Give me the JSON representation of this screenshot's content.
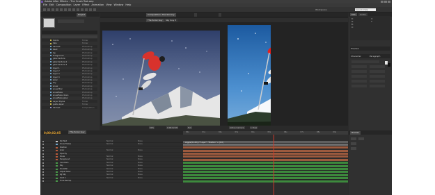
{
  "app": {
    "title": "Adobe After Effects - The Crash Test.aep",
    "menu": [
      "File",
      "Edit",
      "Composition",
      "Layer",
      "Effect",
      "Animation",
      "View",
      "Window",
      "Help"
    ],
    "workspace": "Workspace:",
    "search_placeholder": "Search Help"
  },
  "project": {
    "tab_label": "Project",
    "items": [
      {
        "name": "Solids",
        "type": "Folder",
        "color": "#c9b94c"
      },
      {
        "name": "Skis",
        "type": "Folder",
        "color": "#c9b94c"
      },
      {
        "name": "Ski text",
        "type": "Photoshop",
        "color": "#6fa3c9"
      },
      {
        "name": "back",
        "type": "Photoshop",
        "color": "#6fa3c9"
      },
      {
        "name": "bg",
        "type": "Photoshop",
        "color": "#6fa3c9"
      },
      {
        "name": "foreground",
        "type": "Photoshop",
        "color": "#6fa3c9"
      },
      {
        "name": "glow texture",
        "type": "Photoshop",
        "color": "#6fa3c9"
      },
      {
        "name": "glow texture 2",
        "type": "Photoshop",
        "color": "#6fa3c9"
      },
      {
        "name": "glow texture 3",
        "type": "Photoshop",
        "color": "#6fa3c9"
      },
      {
        "name": "layer 1",
        "type": "Photoshop",
        "color": "#6fa3c9"
      },
      {
        "name": "layer 2",
        "type": "Photoshop",
        "color": "#6fa3c9"
      },
      {
        "name": "layer 3",
        "type": "Photoshop",
        "color": "#6fa3c9"
      },
      {
        "name": "layer 4",
        "type": "Photoshop",
        "color": "#6fa3c9"
      },
      {
        "name": "skier",
        "type": "Photoshop",
        "color": "#6fa3c9"
      },
      {
        "name": "sky",
        "type": "Photoshop",
        "color": "#6fa3c9"
      },
      {
        "name": "snow",
        "type": "Photoshop",
        "color": "#6fa3c9"
      },
      {
        "name": "snow Blur",
        "type": "Photoshop",
        "color": "#6fa3c9"
      },
      {
        "name": "snowflake",
        "type": "Photoshop",
        "color": "#6fa3c9"
      },
      {
        "name": "snowflake down",
        "type": "Photoshop",
        "color": "#6fa3c9"
      },
      {
        "name": "snowflake glow",
        "type": "Photoshop",
        "color": "#6fa3c9"
      },
      {
        "name": "Layer Styles",
        "type": "Folder",
        "color": "#c9b94c"
      },
      {
        "name": "guide layer",
        "type": "Folder",
        "color": "#c9b94c"
      },
      {
        "name": "Ski test",
        "type": "Composition",
        "color": "#8c8cc9"
      }
    ]
  },
  "viewer": {
    "tab_label": "Composition: The Ski Guy",
    "tabs": [
      "The Snow Guy",
      "Sky Guy 2"
    ],
    "footer": [
      "50%",
      "0:00:02:05",
      "Full",
      "Active Camera",
      "1 View"
    ]
  },
  "right_panel": {
    "info_tab": "Info",
    "audio_tab": "Audio",
    "preview_tab": "Preview",
    "char_tab": "Character",
    "paragraph_tab": "Paragraph",
    "values": [
      "R:",
      "G:",
      "B:",
      "A:",
      "X:",
      "Y:"
    ]
  },
  "timeline": {
    "timecode": "0;00;02;05",
    "tab_label": "The Snow Guy",
    "ticks": [
      "00s",
      "01s",
      "02s",
      "03s",
      "04s",
      "05s",
      "06s",
      "07s",
      "08s",
      "09s"
    ],
    "expression": "wiggle(5,100) // \"Layer\", \"Position\" + [0,0]",
    "layers": [
      {
        "name": "Ski Text",
        "mode": "Normal",
        "parent": "None",
        "color": "#c8c8c8",
        "bar": "#5f5f5f"
      },
      {
        "name": "Snow Flakes",
        "mode": "Normal",
        "parent": "None",
        "color": "#6fa3c9",
        "bar": "#6f6f6f"
      },
      {
        "name": "Position",
        "mode": "",
        "parent": "",
        "color": "#b85a3a",
        "bar": "#9c5a3e"
      },
      {
        "name": "skier",
        "mode": "Normal",
        "parent": "None",
        "color": "#b85a3a",
        "bar": "#9c5a3e"
      },
      {
        "name": "Opacity",
        "mode": "",
        "parent": "",
        "color": "#b85a3a",
        "bar": "#9c5a3e"
      },
      {
        "name": "Snow",
        "mode": "Normal",
        "parent": "None",
        "color": "#b85a3a",
        "bar": "#9c5a3e"
      },
      {
        "name": "foreground",
        "mode": "Normal",
        "parent": "None",
        "color": "#b85a3a",
        "bar": "#9c5a3e"
      },
      {
        "name": "mountain",
        "mode": "Normal",
        "parent": "None",
        "color": "#4a9a4a",
        "bar": "#3d8a3d"
      },
      {
        "name": "Sky",
        "mode": "Normal",
        "parent": "None",
        "color": "#4a9a4a",
        "bar": "#3d8a3d"
      },
      {
        "name": "Snowfall",
        "mode": "Normal",
        "parent": "None",
        "color": "#4a9a4a",
        "bar": "#3d8a3d"
      },
      {
        "name": "Adjust Glow",
        "mode": "Normal",
        "parent": "None",
        "color": "#4a9a4a",
        "bar": "#3d8a3d"
      },
      {
        "name": "bg Sky",
        "mode": "Normal",
        "parent": "None",
        "color": "#4a9a4a",
        "bar": "#3d8a3d"
      },
      {
        "name": "Solid 1",
        "mode": "Normal",
        "parent": "None",
        "color": "#4a9a4a",
        "bar": "#3d8a3d"
      },
      {
        "name": "Time Remap",
        "mode": "",
        "parent": "",
        "color": "#4a9a4a",
        "bar": "#3d8a3d"
      }
    ]
  },
  "tracker": {
    "tab_label": "Tracker"
  }
}
